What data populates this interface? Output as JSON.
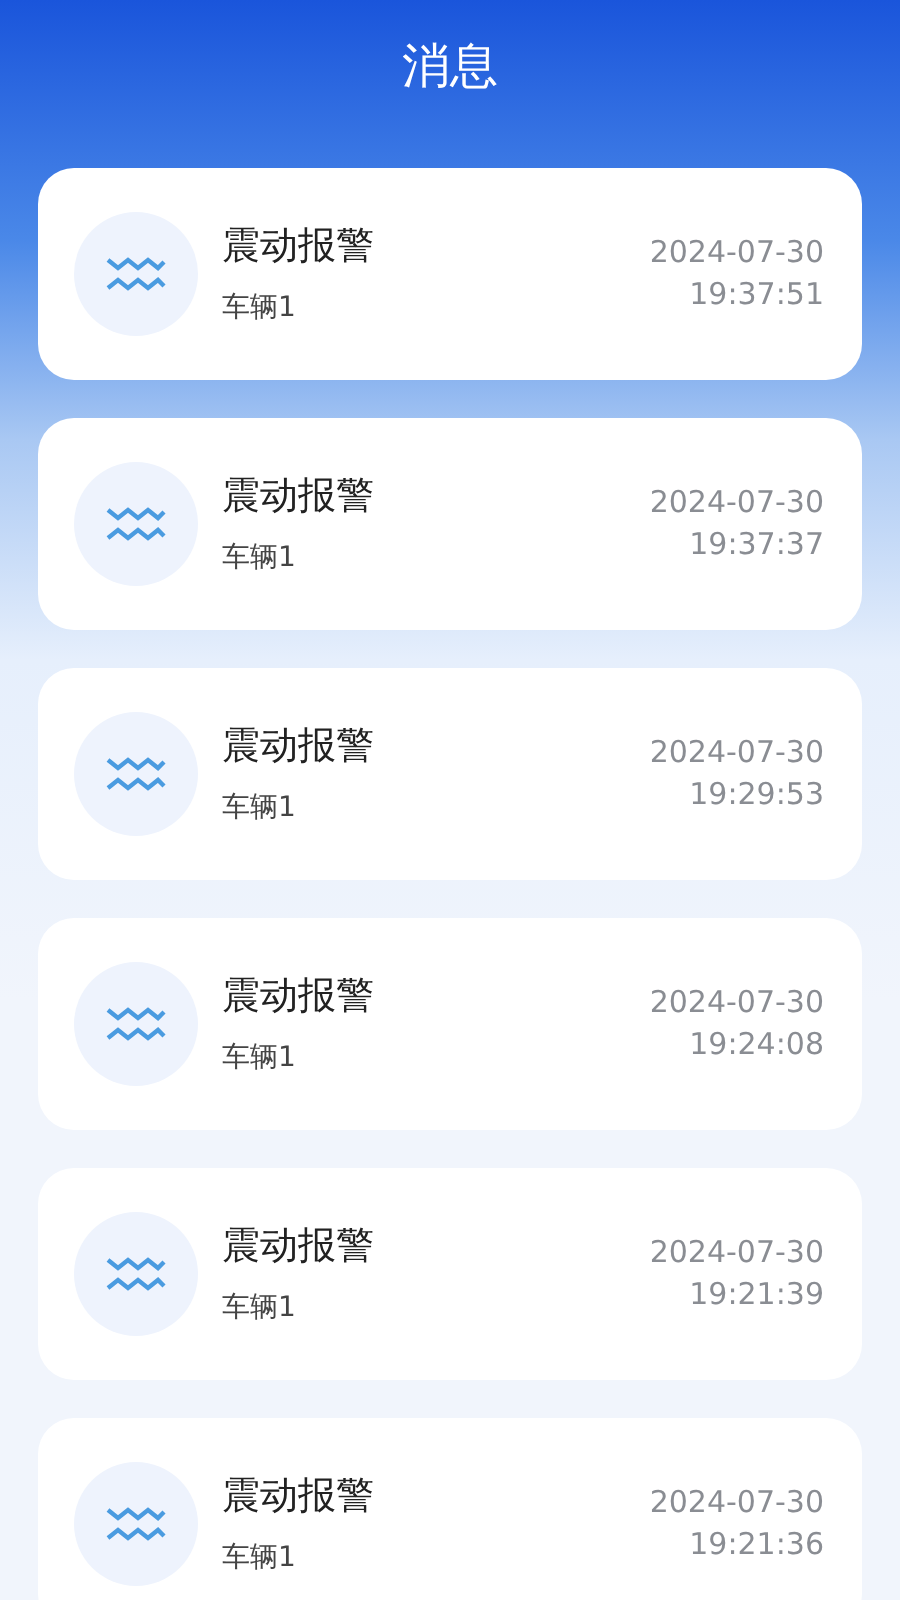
{
  "header": {
    "title": "消息"
  },
  "messages": [
    {
      "title": "震动报警",
      "vehicle": "车辆1",
      "date": "2024-07-30",
      "time": "19:37:51"
    },
    {
      "title": "震动报警",
      "vehicle": "车辆1",
      "date": "2024-07-30",
      "time": "19:37:37"
    },
    {
      "title": "震动报警",
      "vehicle": "车辆1",
      "date": "2024-07-30",
      "time": "19:29:53"
    },
    {
      "title": "震动报警",
      "vehicle": "车辆1",
      "date": "2024-07-30",
      "time": "19:24:08"
    },
    {
      "title": "震动报警",
      "vehicle": "车辆1",
      "date": "2024-07-30",
      "time": "19:21:39"
    },
    {
      "title": "震动报警",
      "vehicle": "车辆1",
      "date": "2024-07-30",
      "time": "19:21:36"
    }
  ]
}
